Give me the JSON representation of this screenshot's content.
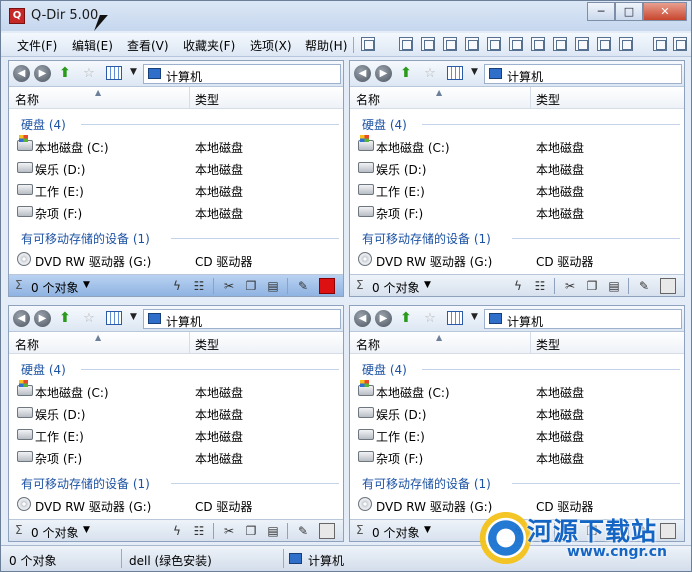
{
  "window": {
    "title": "Q-Dir 5.00",
    "icon": "qdir-app-icon",
    "controls": {
      "minimize": "─",
      "maximize": "□",
      "close": "✕"
    }
  },
  "menu": {
    "items": [
      "文件(F)",
      "编辑(E)",
      "查看(V)",
      "收藏夹(F)",
      "选项(X)",
      "帮助(H)"
    ]
  },
  "panes": [
    {
      "address": "计算机",
      "columns": {
        "name": "名称",
        "type": "类型"
      },
      "groups": [
        {
          "header": "硬盘 (4)",
          "rows": [
            {
              "name": "本地磁盘 (C:)",
              "type": "本地磁盘",
              "icon": "system-drive-icon"
            },
            {
              "name": "娱乐 (D:)",
              "type": "本地磁盘",
              "icon": "drive-icon"
            },
            {
              "name": "工作 (E:)",
              "type": "本地磁盘",
              "icon": "drive-icon"
            },
            {
              "name": "杂项 (F:)",
              "type": "本地磁盘",
              "icon": "drive-icon"
            }
          ]
        },
        {
          "header": "有可移动存储的设备 (1)",
          "rows": [
            {
              "name": "DVD RW 驱动器 (G:)",
              "type": "CD 驱动器",
              "icon": "dvd-drive-icon"
            }
          ]
        }
      ],
      "status": {
        "sigma": "Σ",
        "count": "0 个对象"
      },
      "active": true
    },
    {
      "address": "计算机",
      "columns": {
        "name": "名称",
        "type": "类型"
      },
      "groups": [
        {
          "header": "硬盘 (4)",
          "rows": [
            {
              "name": "本地磁盘 (C:)",
              "type": "本地磁盘",
              "icon": "system-drive-icon"
            },
            {
              "name": "娱乐 (D:)",
              "type": "本地磁盘",
              "icon": "drive-icon"
            },
            {
              "name": "工作 (E:)",
              "type": "本地磁盘",
              "icon": "drive-icon"
            },
            {
              "name": "杂项 (F:)",
              "type": "本地磁盘",
              "icon": "drive-icon"
            }
          ]
        },
        {
          "header": "有可移动存储的设备 (1)",
          "rows": [
            {
              "name": "DVD RW 驱动器 (G:)",
              "type": "CD 驱动器",
              "icon": "dvd-drive-icon"
            }
          ]
        }
      ],
      "status": {
        "sigma": "Σ",
        "count": "0 个对象"
      },
      "active": false
    },
    {
      "address": "计算机",
      "columns": {
        "name": "名称",
        "type": "类型"
      },
      "groups": [
        {
          "header": "硬盘 (4)",
          "rows": [
            {
              "name": "本地磁盘 (C:)",
              "type": "本地磁盘",
              "icon": "system-drive-icon"
            },
            {
              "name": "娱乐 (D:)",
              "type": "本地磁盘",
              "icon": "drive-icon"
            },
            {
              "name": "工作 (E:)",
              "type": "本地磁盘",
              "icon": "drive-icon"
            },
            {
              "name": "杂项 (F:)",
              "type": "本地磁盘",
              "icon": "drive-icon"
            }
          ]
        },
        {
          "header": "有可移动存储的设备 (1)",
          "rows": [
            {
              "name": "DVD RW 驱动器 (G:)",
              "type": "CD 驱动器",
              "icon": "dvd-drive-icon"
            }
          ]
        }
      ],
      "status": {
        "sigma": "Σ",
        "count": "0 个对象"
      },
      "active": false
    },
    {
      "address": "计算机",
      "columns": {
        "name": "名称",
        "type": "类型"
      },
      "groups": [
        {
          "header": "硬盘 (4)",
          "rows": [
            {
              "name": "本地磁盘 (C:)",
              "type": "本地磁盘",
              "icon": "system-drive-icon"
            },
            {
              "name": "娱乐 (D:)",
              "type": "本地磁盘",
              "icon": "drive-icon"
            },
            {
              "name": "工作 (E:)",
              "type": "本地磁盘",
              "icon": "drive-icon"
            },
            {
              "name": "杂项 (F:)",
              "type": "本地磁盘",
              "icon": "drive-icon"
            }
          ]
        },
        {
          "header": "有可移动存储的设备 (1)",
          "rows": [
            {
              "name": "DVD RW 驱动器 (G:)",
              "type": "CD 驱动器",
              "icon": "dvd-drive-icon"
            }
          ]
        }
      ],
      "status": {
        "sigma": "Σ",
        "count": "0 个对象"
      },
      "active": false
    }
  ],
  "statusbar": {
    "count": "0 个对象",
    "user": "dell (绿色安装)",
    "location": "计算机"
  },
  "watermark": {
    "title": "河源下载站",
    "url": "www.cngr.cn"
  },
  "colors": {
    "group_header": "#1c52a3",
    "active_status": "#8fb3e2",
    "frame": "#c9d9ec"
  }
}
